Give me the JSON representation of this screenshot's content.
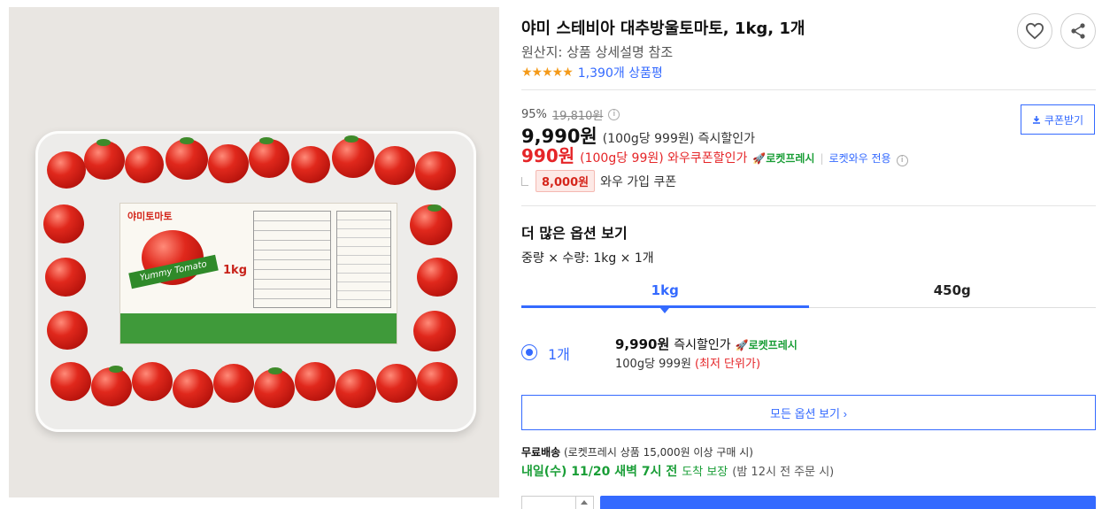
{
  "product": {
    "title": "야미 스테비아 대추방울토마토, 1kg, 1개",
    "origin": "원산지: 상품 상세설명 참조",
    "rating_stars": "★★★★★",
    "rating_value": 4.5,
    "review_count": "1,390개 상품평",
    "image_alt": "야미토마토 Stevia Yummy Tomato 1kg"
  },
  "image_label": {
    "brand": "야미토마토",
    "banner": "Yummy Tomato",
    "weight": "1kg"
  },
  "actions": {
    "wishlist_icon": "heart-icon",
    "share_icon": "share-icon"
  },
  "pricing": {
    "discount_rate": "95%",
    "original_price": "19,810원",
    "sale_price": "9,990원",
    "sale_unit": "(100g당 999원) 즉시할인가",
    "coupon_price": "990원",
    "coupon_unit": "(100g당 99원) 와우쿠폰할인가",
    "rocket_label": "🚀로켓프레시",
    "wow_only": "로켓와우 전용",
    "wow_coupon_amount": "8,000원",
    "wow_coupon_text": "와우 가입 쿠폰",
    "coupon_button": "쿠폰받기"
  },
  "options": {
    "heading": "더 많은 옵션 보기",
    "summary": "중량 × 수량: 1kg × 1개",
    "tabs": [
      {
        "label": "1kg"
      },
      {
        "label": "450g"
      }
    ],
    "selected_item": {
      "qty": "1개",
      "price": "9,990원",
      "price_note": "즉시할인가",
      "rocket": "🚀로켓프레시",
      "unit_price": "100g당 999원",
      "lowest_label": "(최저 단위가)"
    },
    "all_options_button": "모든 옵션 보기 ›"
  },
  "shipping": {
    "free_label": "무료배송",
    "free_condition": "(로켓프레시 상품 15,000원 이상 구매 시)",
    "delivery_date": "내일(수) 11/20 새벽 7시 전",
    "delivery_guarantee": "도착 보장",
    "delivery_condition": "(밤 12시 전 주문 시)"
  },
  "colors": {
    "accent": "#346aff",
    "sale_red": "#e52528",
    "rocket_green": "#1a9e37",
    "star": "#f49a19"
  }
}
